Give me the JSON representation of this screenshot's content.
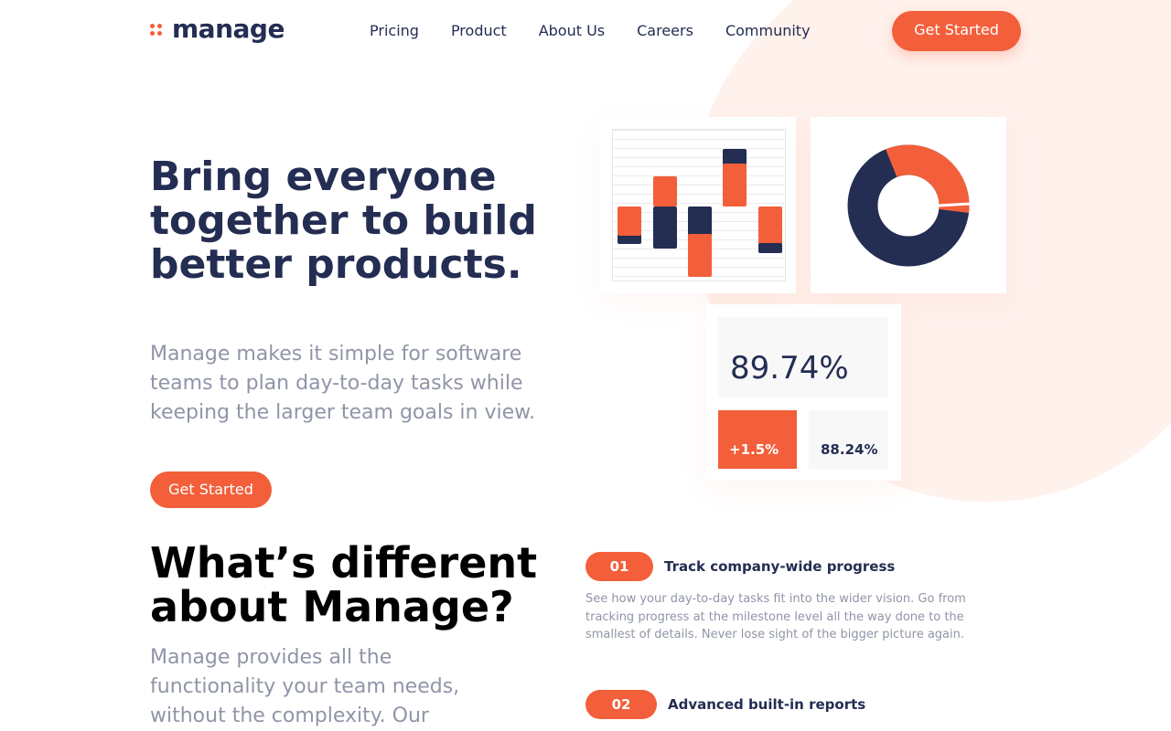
{
  "brand": {
    "name": "manage",
    "primary_color": "#f25f3a",
    "dark_color": "#242d52"
  },
  "nav": {
    "items": [
      "Pricing",
      "Product",
      "About Us",
      "Careers",
      "Community"
    ],
    "cta_label": "Get Started"
  },
  "hero": {
    "title": "Bring everyone together to build better products.",
    "subtitle": "Manage makes it simple for software teams to plan day-to-day tasks while keeping the larger team goals in view.",
    "cta_label": "Get Started"
  },
  "dashboard": {
    "main_stat": "89.74%",
    "change_stat": "+1.5%",
    "secondary_stat": "88.24%",
    "donut_share_orange": 0.33
  },
  "section": {
    "title": "What’s different about Manage?",
    "subtitle": "Manage provides all the functionality your team needs, without the complexity. Our"
  },
  "features": [
    {
      "number": "01",
      "title": "Track company-wide progress",
      "body": "See how your day-to-day tasks fit into the wider vision. Go from tracking progress at the milestone level all the way done to the smallest of details. Never lose sight of the bigger picture again."
    },
    {
      "number": "02",
      "title": "Advanced built-in reports",
      "body": ""
    }
  ]
}
